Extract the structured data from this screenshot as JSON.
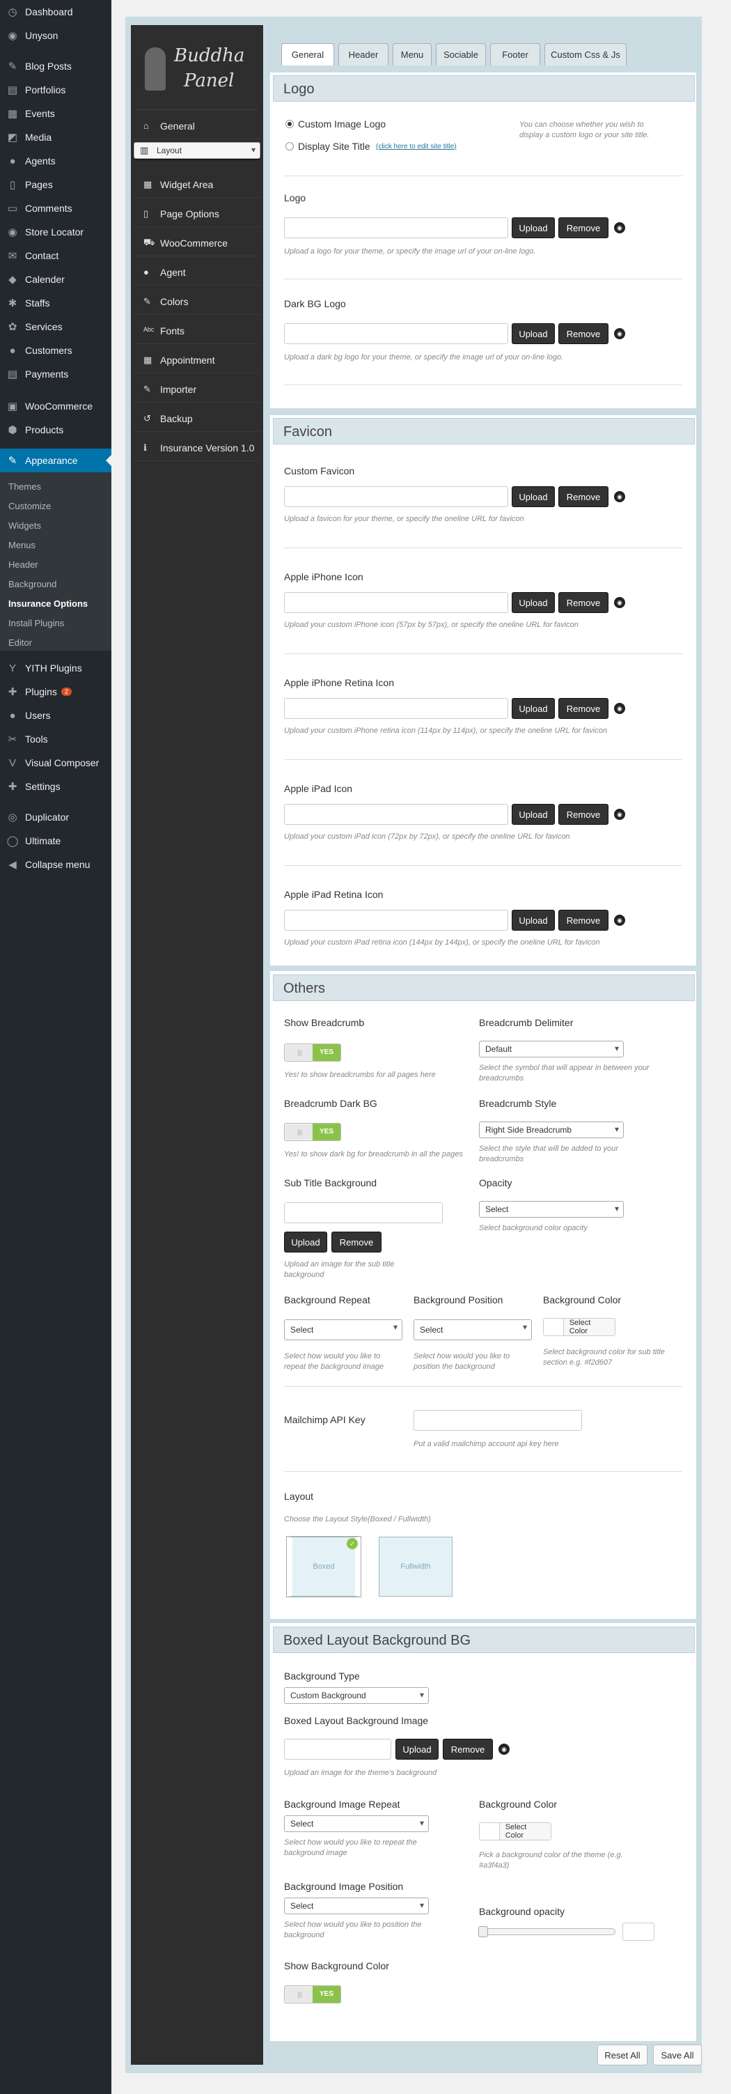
{
  "menu": {
    "top": [
      {
        "label": "Dashboard",
        "icon": "dashboard-icon",
        "glyph": "◷"
      },
      {
        "label": "Unyson",
        "icon": "unyson-icon",
        "glyph": "◉"
      }
    ],
    "items": [
      {
        "label": "Blog Posts",
        "icon": "pin-icon",
        "glyph": "✎"
      },
      {
        "label": "Portfolios",
        "icon": "portfolio-icon",
        "glyph": "▤"
      },
      {
        "label": "Events",
        "icon": "calendar-icon",
        "glyph": "▦"
      },
      {
        "label": "Media",
        "icon": "media-icon",
        "glyph": "◩"
      },
      {
        "label": "Agents",
        "icon": "user-icon",
        "glyph": "●"
      },
      {
        "label": "Pages",
        "icon": "page-icon",
        "glyph": "▯"
      },
      {
        "label": "Comments",
        "icon": "comment-icon",
        "glyph": "▭"
      },
      {
        "label": "Store Locator",
        "icon": "location-icon",
        "glyph": "◉"
      },
      {
        "label": "Contact",
        "icon": "mail-icon",
        "glyph": "✉"
      },
      {
        "label": "Calender",
        "icon": "tag-icon",
        "glyph": "◆"
      },
      {
        "label": "Staffs",
        "icon": "staff-icon",
        "glyph": "✱"
      },
      {
        "label": "Services",
        "icon": "services-icon",
        "glyph": "✿"
      },
      {
        "label": "Customers",
        "icon": "customers-icon",
        "glyph": "●"
      },
      {
        "label": "Payments",
        "icon": "payment-icon",
        "glyph": "▤"
      }
    ],
    "shop": [
      {
        "label": "WooCommerce",
        "icon": "woocommerce-icon",
        "glyph": "▣"
      },
      {
        "label": "Products",
        "icon": "products-icon",
        "glyph": "⬢"
      }
    ],
    "appearance": {
      "label": "Appearance",
      "icon": "brush-icon",
      "glyph": "✎"
    },
    "appearance_sub": [
      "Themes",
      "Customize",
      "Widgets",
      "Menus",
      "Header",
      "Background",
      "Insurance Options",
      "Install Plugins",
      "Editor"
    ],
    "appearance_current": "Insurance Options",
    "lower": [
      {
        "label": "YITH Plugins",
        "icon": "yith-icon",
        "glyph": "Y"
      },
      {
        "label": "Plugins",
        "icon": "plugin-icon",
        "glyph": "✚",
        "badge": "2"
      },
      {
        "label": "Users",
        "icon": "users-icon",
        "glyph": "●"
      },
      {
        "label": "Tools",
        "icon": "tools-icon",
        "glyph": "✂"
      },
      {
        "label": "Visual Composer",
        "icon": "composer-icon",
        "glyph": "V"
      },
      {
        "label": "Settings",
        "icon": "settings-icon",
        "glyph": "✚"
      }
    ],
    "bottom": [
      {
        "label": "Duplicator",
        "icon": "duplicator-icon",
        "glyph": "◎"
      },
      {
        "label": "Ultimate",
        "icon": "ultimate-icon",
        "glyph": "◯"
      },
      {
        "label": "Collapse menu",
        "icon": "collapse-icon",
        "glyph": "◀"
      }
    ]
  },
  "panel": {
    "logo_line1": "Buddha",
    "logo_line2": "Panel",
    "nav": [
      {
        "label": "General",
        "icon": "home-icon",
        "glyph": "⌂"
      },
      {
        "label": "Layout",
        "icon": "layout-icon",
        "glyph": "▥"
      },
      {
        "label": "Widget Area",
        "icon": "widget-icon",
        "glyph": "▦"
      },
      {
        "label": "Page Options",
        "icon": "page-options-icon",
        "glyph": "▯"
      },
      {
        "label": "WooCommerce",
        "icon": "cart-icon",
        "glyph": "⛟"
      },
      {
        "label": "Agent",
        "icon": "agent-icon",
        "glyph": "●"
      },
      {
        "label": "Colors",
        "icon": "colors-icon",
        "glyph": "✎"
      },
      {
        "label": "Fonts",
        "icon": "fonts-icon",
        "glyph": "ᴬᵇᶜ"
      },
      {
        "label": "Appointment",
        "icon": "appointment-icon",
        "glyph": "▦"
      },
      {
        "label": "Importer",
        "icon": "importer-icon",
        "glyph": "✎"
      },
      {
        "label": "Backup",
        "icon": "backup-icon",
        "glyph": "↺"
      },
      {
        "label": "Insurance Version 1.0",
        "icon": "info-icon",
        "glyph": "ℹ"
      }
    ],
    "selected_nav": "Layout"
  },
  "tabs": [
    "General",
    "Header",
    "Menu",
    "Sociable",
    "Footer",
    "Custom Css & Js"
  ],
  "active_tab": "General",
  "buttons": {
    "upload": "Upload",
    "remove": "Remove",
    "select_color": "Select Color",
    "reset": "Reset All",
    "save": "Save All"
  },
  "logo_section": {
    "title": "Logo",
    "radio1": "Custom Image Logo",
    "radio2": "Display Site Title",
    "radio2_link": "(click here to edit site title)",
    "radio_desc": "You can choose whether you wish to display a custom logo or your site title.",
    "logo_label": "Logo",
    "logo_desc": "Upload a logo for your theme, or specify the image url of your on-line logo.",
    "dark_label": "Dark BG Logo",
    "dark_desc": "Upload a dark bg logo for your theme, or specify the image url of your on-line logo."
  },
  "favicon_section": {
    "title": "Favicon",
    "fields": [
      {
        "label": "Custom Favicon",
        "desc": "Upload a favicon for your theme, or specify the oneline URL for favicon"
      },
      {
        "label": "Apple iPhone Icon",
        "desc": "Upload your custom iPhone icon (57px by 57px), or specify the oneline URL for favicon"
      },
      {
        "label": "Apple iPhone Retina Icon",
        "desc": "Upload your custom iPhone retina icon (114px by 114px), or specify the oneline URL for favicon"
      },
      {
        "label": "Apple iPad Icon",
        "desc": "Upload your custom iPad icon (72px by 72px), or specify the oneline URL for favicon"
      },
      {
        "label": "Apple iPad Retina Icon",
        "desc": "Upload your custom iPad retina icon (144px by 144px), or specify the oneline URL for favicon"
      }
    ]
  },
  "others": {
    "title": "Others",
    "show_breadcrumb": "Show Breadcrumb",
    "show_breadcrumb_desc": "Yes! to show breadcrumbs for all pages here",
    "delimiter": "Breadcrumb Delimiter",
    "delimiter_value": "Default",
    "delimiter_desc": "Select the symbol that will appear in between your breadcrumbs",
    "dark_bg": "Breadcrumb Dark BG",
    "dark_bg_desc": "Yes! to show dark bg for breadcrumb in all the pages",
    "style": "Breadcrumb Style",
    "style_value": "Right Side Breadcrumb",
    "style_desc": "Select the style that will be added to your breadcrumbs",
    "subtitle_bg": "Sub Title Background",
    "subtitle_bg_desc": "Upload an image for the sub title background",
    "opacity": "Opacity",
    "opacity_value": "Select",
    "opacity_desc": "Select background color opacity",
    "bg_repeat": "Background Repeat",
    "bg_repeat_value": "Select",
    "bg_repeat_desc": "Select how would you like to repeat the background image",
    "bg_position": "Background Position",
    "bg_position_value": "Select",
    "bg_position_desc": "Select how would you like to position the background",
    "bg_color": "Background Color",
    "bg_color_desc": "Select background color for sub title section e.g. #f2d607",
    "mailchimp": "Mailchimp API Key",
    "mailchimp_desc": "Put a valid mailchimp account api key here",
    "layout": "Layout",
    "layout_desc": "Choose the Layout Style(Boxed / Fullwidth)",
    "layout_boxed": "Boxed",
    "layout_full": "Fullwidth",
    "toggle_yes": "YES"
  },
  "boxed": {
    "title": "Boxed Layout Background BG",
    "type": "Background Type",
    "type_value": "Custom Background",
    "image": "Boxed Layout Background Image",
    "image_desc": "Upload an image for the theme's background",
    "repeat": "Background Image Repeat",
    "repeat_value": "Select",
    "repeat_desc": "Select how would you like to repeat the background image",
    "color": "Background Color",
    "color_desc": "Pick a background color of the theme (e.g. #a3f4a3)",
    "position": "Background Image Position",
    "position_value": "Select",
    "position_desc": "Select how would you like to position the background",
    "opacity": "Background opacity",
    "show_color": "Show Background Color"
  }
}
